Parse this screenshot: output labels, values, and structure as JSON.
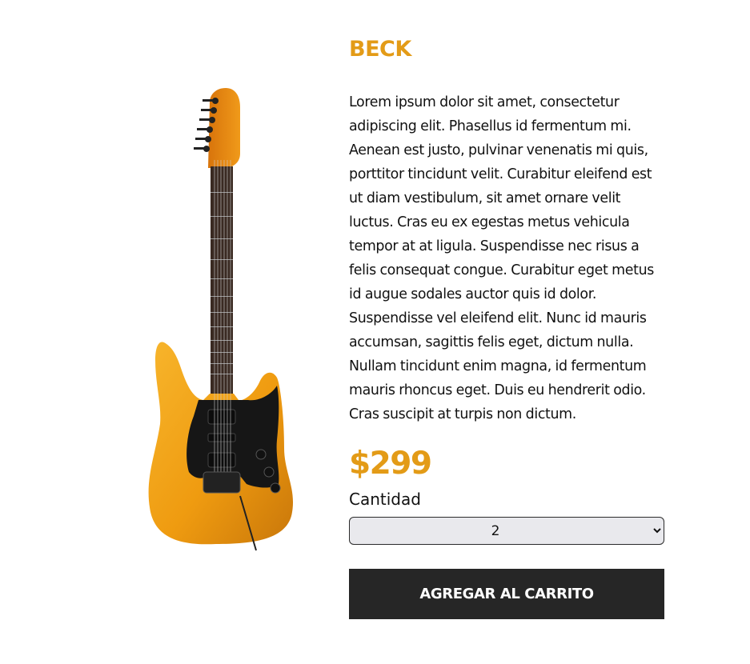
{
  "product": {
    "title": "BECK",
    "description": "Lorem ipsum dolor sit amet, consectetur adipiscing elit. Phasellus id fermentum mi. Aenean est justo, pulvinar venenatis mi quis, porttitor tincidunt velit. Curabitur eleifend est ut diam vestibulum, sit amet ornare velit luctus. Cras eu ex egestas metus vehicula tempor at at ligula. Suspendisse nec risus a felis consequat congue. Curabitur eget metus id augue sodales auctor quis id dolor. Suspendisse vel eleifend elit. Nunc id mauris accumsan, sagittis felis eget, dictum nulla. Nullam tincidunt enim magna, id fermentum mauris rhoncus eget. Duis eu hendrerit odio. Cras suscipit at turpis non dictum.",
    "price": "$299",
    "image_icon": "electric-guitar-icon"
  },
  "quantity": {
    "label": "Cantidad",
    "selected": "2"
  },
  "cart": {
    "add_label": "AGREGAR AL CARRITO"
  },
  "colors": {
    "accent": "#e39b17",
    "button_bg": "#262626",
    "select_bg": "#e9e9ed"
  }
}
